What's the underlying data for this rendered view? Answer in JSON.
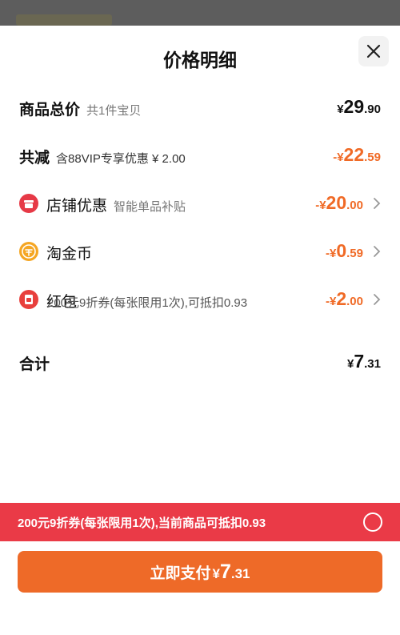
{
  "title": "价格明细",
  "rows": {
    "total": {
      "label": "商品总价",
      "sub": "共1件宝贝",
      "cur": "¥",
      "int": "29",
      "dec": ".90"
    },
    "reduce": {
      "label": "共减",
      "sub": "含88VIP专享优惠 ¥ 2.00",
      "prefix": "-",
      "cur": "¥",
      "int": "22",
      "dec": ".59"
    },
    "shop": {
      "label": "店铺优惠",
      "sub": "智能单品补贴",
      "prefix": "-",
      "cur": "¥",
      "int": "20",
      "dec": ".00"
    },
    "coins": {
      "label": "淘金币",
      "prefix": "-",
      "cur": "¥",
      "int": "0",
      "dec": ".59"
    },
    "redpacket": {
      "label": "红包",
      "prefix": "-",
      "cur": "¥",
      "int": "2",
      "dec": ".00",
      "note": "200元9折券(每张限用1次),可抵扣0.93"
    },
    "sum": {
      "label": "合计",
      "cur": "¥",
      "int": "7",
      "dec": ".31"
    }
  },
  "banner": {
    "text": "200元9折券(每张限用1次),当前商品可抵扣0.93"
  },
  "pay": {
    "label": "立即支付",
    "cur": "¥",
    "int": "7",
    "dec": ".31"
  },
  "colors": {
    "accent": "#f06a26",
    "banner": "#ea3a47",
    "pay_button": "#ee6a28",
    "shop_icon": "#e63946",
    "coin_icon": "#f5a623",
    "redpacket_icon": "#e8403d"
  },
  "icons": {
    "close": "close-icon",
    "shop": "shop-icon",
    "coin": "coin-icon",
    "redpacket": "red-packet-icon",
    "chevron": "chevron-right-icon"
  }
}
